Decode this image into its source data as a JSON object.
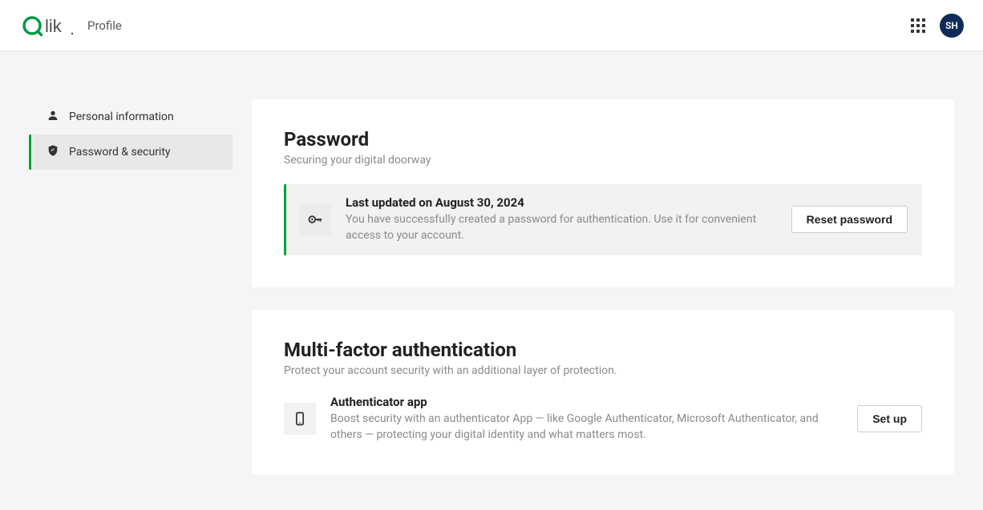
{
  "header": {
    "page_label": "Profile",
    "avatar_initials": "SH"
  },
  "sidebar": {
    "items": [
      {
        "label": "Personal information"
      },
      {
        "label": "Password & security"
      }
    ]
  },
  "password_card": {
    "title": "Password",
    "subtitle": "Securing your digital doorway",
    "row": {
      "title": "Last updated on August 30, 2024",
      "desc": "You have successfully created a password for authentication. Use it for convenient access to your account.",
      "button": "Reset password"
    }
  },
  "mfa_card": {
    "title": "Multi-factor authentication",
    "subtitle": "Protect your account security with an additional layer of protection.",
    "row": {
      "title": "Authenticator app",
      "desc": "Boost security with an authenticator App — like Google Authenticator, Microsoft Authenticator, and others — protecting your digital identity and what matters most.",
      "button": "Set up"
    }
  }
}
